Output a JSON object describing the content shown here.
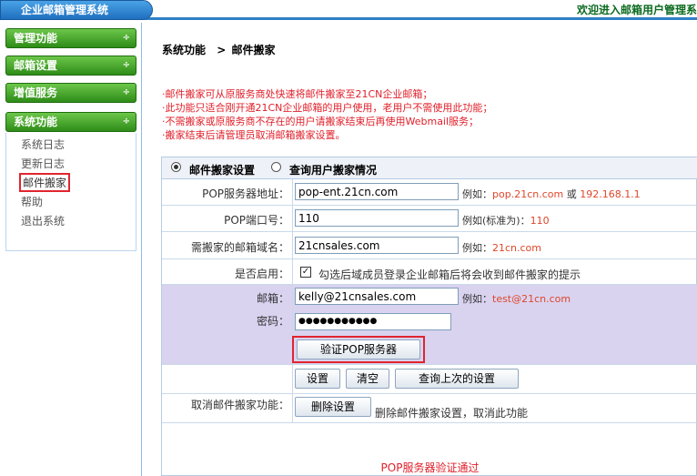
{
  "header": {
    "app_title": "企业邮箱管理系统",
    "welcome": "欢迎进入邮箱用户管理系"
  },
  "sidebar": {
    "menus": [
      "管理功能",
      "邮箱设置",
      "增值服务",
      "系统功能"
    ],
    "arrow": "÷",
    "system_items": [
      "系统日志",
      "更新日志",
      "邮件搬家",
      "帮助",
      "退出系统"
    ],
    "active_item": "邮件搬家"
  },
  "breadcrumb": {
    "root": "系统功能",
    "sep": ">",
    "current": "邮件搬家"
  },
  "notes": [
    "·邮件搬家可从原服务商处快速将邮件搬家至21CN企业邮箱；",
    "·此功能只适合刚开通21CN企业邮箱的用户使用，老用户不需使用此功能；",
    "·不需搬家或原服务商不存在的用户请搬家结束后再使用Webmail服务；",
    "·搬家结束后请管理员取消邮箱搬家设置。"
  ],
  "tabs": {
    "settings": "邮件搬家设置",
    "query": "查询用户搬家情况"
  },
  "form": {
    "pop_server": {
      "label": "POP服务器地址：",
      "value": "pop-ent.21cn.com",
      "hint_prefix": "例如：",
      "hint_example1": "pop.21cn.com",
      "hint_or": " 或 ",
      "hint_example2": "192.168.1.1"
    },
    "pop_port": {
      "label": "POP端口号：",
      "value": "110",
      "hint_prefix": "例如(标准为)：",
      "hint_example": "110"
    },
    "domain": {
      "label": "需搬家的邮箱域名：",
      "value": "21cnsales.com",
      "hint_prefix": "例如：",
      "hint_example": "21cn.com"
    },
    "enabled": {
      "label": "是否启用：",
      "check": "✓",
      "text": "勾选后域成员登录企业邮箱后将会收到邮件搬家的提示"
    },
    "email": {
      "label": "邮箱：",
      "value": "kelly@21cnsales.com",
      "hint_prefix": "例如：",
      "hint_example": "test@21cn.com"
    },
    "password": {
      "label": "密码：",
      "value": "●●●●●●●●●●●"
    },
    "verify_button": "验证POP服务器",
    "buttons": {
      "set": "设置",
      "clear": "清空",
      "query_last": "查询上次的设置"
    },
    "cancel": {
      "label": "取消邮件搬家功能：",
      "button": "删除设置",
      "text": "删除邮件搬家设置，取消此功能"
    },
    "verify_result": "POP服务器验证通过"
  }
}
